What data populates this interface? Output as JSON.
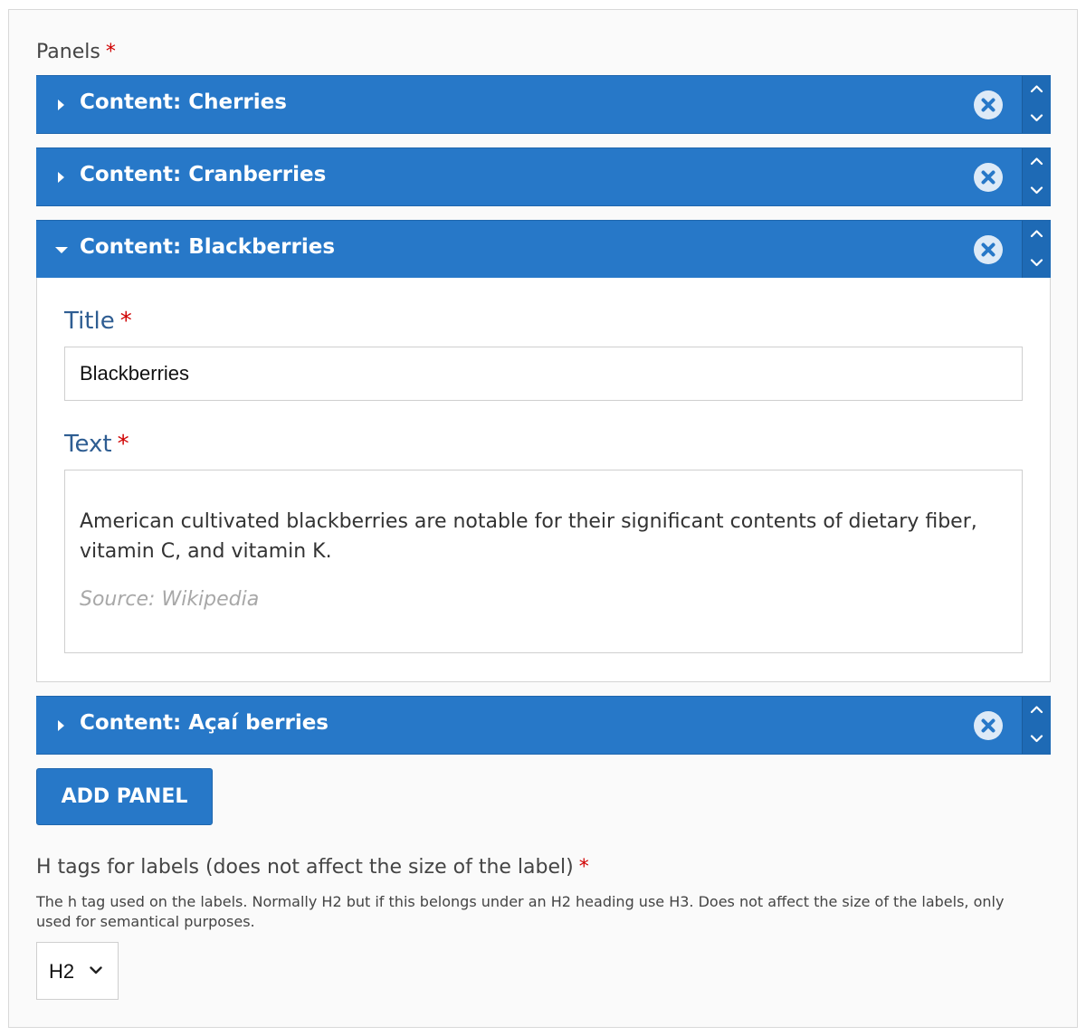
{
  "panels_field": {
    "label": "Panels",
    "required_mark": "*"
  },
  "panels": [
    {
      "title": "Content: Cherries",
      "expanded": false
    },
    {
      "title": "Content: Cranberries",
      "expanded": false
    },
    {
      "title": "Content: Blackberries",
      "expanded": true
    },
    {
      "title": "Content: Açaí berries",
      "expanded": false
    }
  ],
  "icons": {
    "expand": "caret-right-icon",
    "collapse": "caret-down-icon",
    "remove": "remove-circle-icon",
    "move_up": "chevron-up-icon",
    "move_down": "chevron-down-icon"
  },
  "expanded_panel": {
    "title_label": "Title",
    "title_value": "Blackberries",
    "text_label": "Text",
    "text_body": "American cultivated blackberries are notable for their significant contents of dietary fiber, vitamin C, and vitamin K.",
    "text_source": "Source: Wikipedia"
  },
  "add_button": {
    "label": "ADD PANEL"
  },
  "htag_field": {
    "label": "H tags for labels (does not affect the size of the label)",
    "description": "The h tag used on the labels. Normally H2 but if this belongs under an H2 heading use H3. Does not affect the size of the labels, only used for semantical purposes.",
    "selected": "H2"
  },
  "colors": {
    "panel_blue": "#2778c8",
    "reorder_blue": "#1e6ab5",
    "label_blue": "#2e5d92",
    "required_red": "#d00000"
  }
}
